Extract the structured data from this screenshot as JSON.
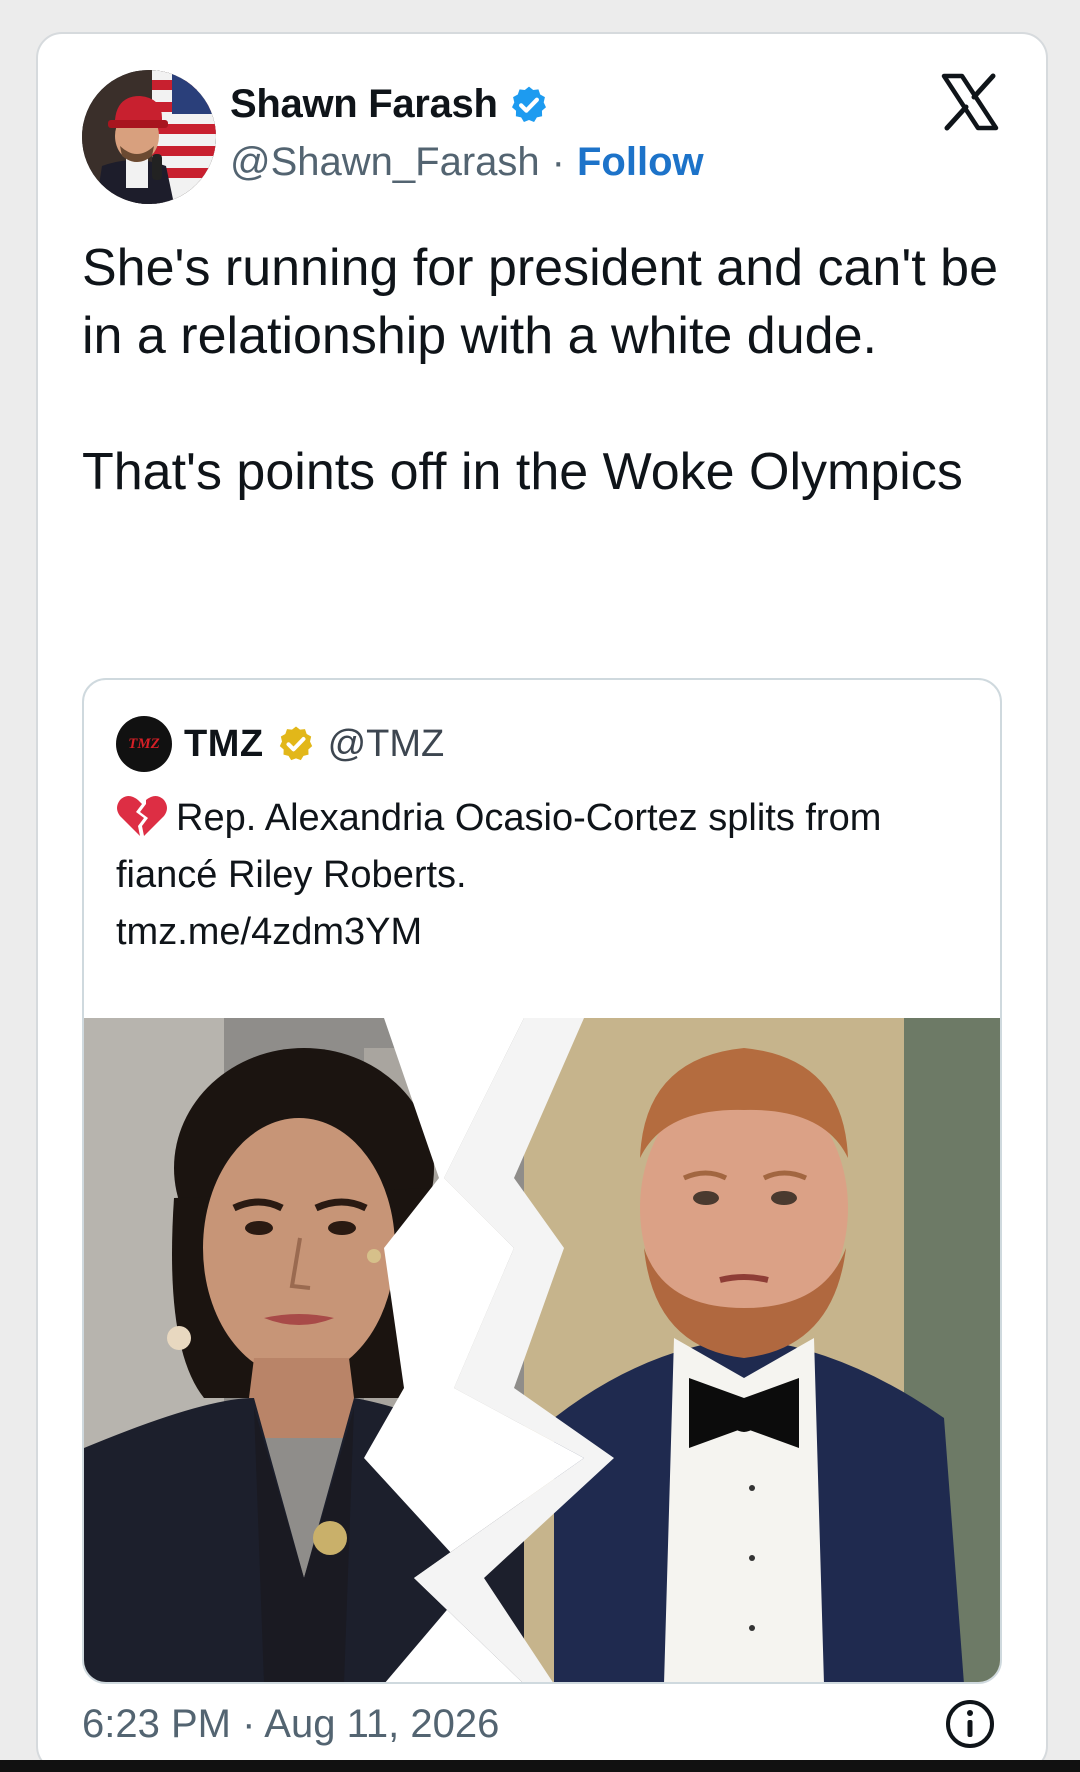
{
  "tweet": {
    "author_name": "Shawn Farash",
    "handle": "@Shawn_Farash",
    "separator": "·",
    "follow_label": "Follow",
    "text_paragraphs": [
      "She's running for president and can't be in a relationship with a white dude.",
      "That's points off in the Woke Olympics"
    ],
    "timestamp": "6:23 PM · Aug 11, 2026"
  },
  "quoted": {
    "avatar_text": "TMZ",
    "name": "TMZ",
    "handle": "@TMZ",
    "text": "Rep. Alexandria Ocasio-Cortez splits from fiancé Riley Roberts.",
    "link": "tmz.me/4zdm3YM"
  },
  "icons": {
    "logo": "x-logo-icon",
    "verified_author": "verified-badge-icon",
    "verified_quoted": "gold-verified-badge-icon",
    "emoji": "broken-heart-icon",
    "info": "info-icon"
  },
  "colors": {
    "verified_blue": "#1d9bf0",
    "verified_gold": "#e2b719",
    "follow_blue": "#1d73c9",
    "text_dark": "#0f1419",
    "text_gray": "#536471"
  }
}
